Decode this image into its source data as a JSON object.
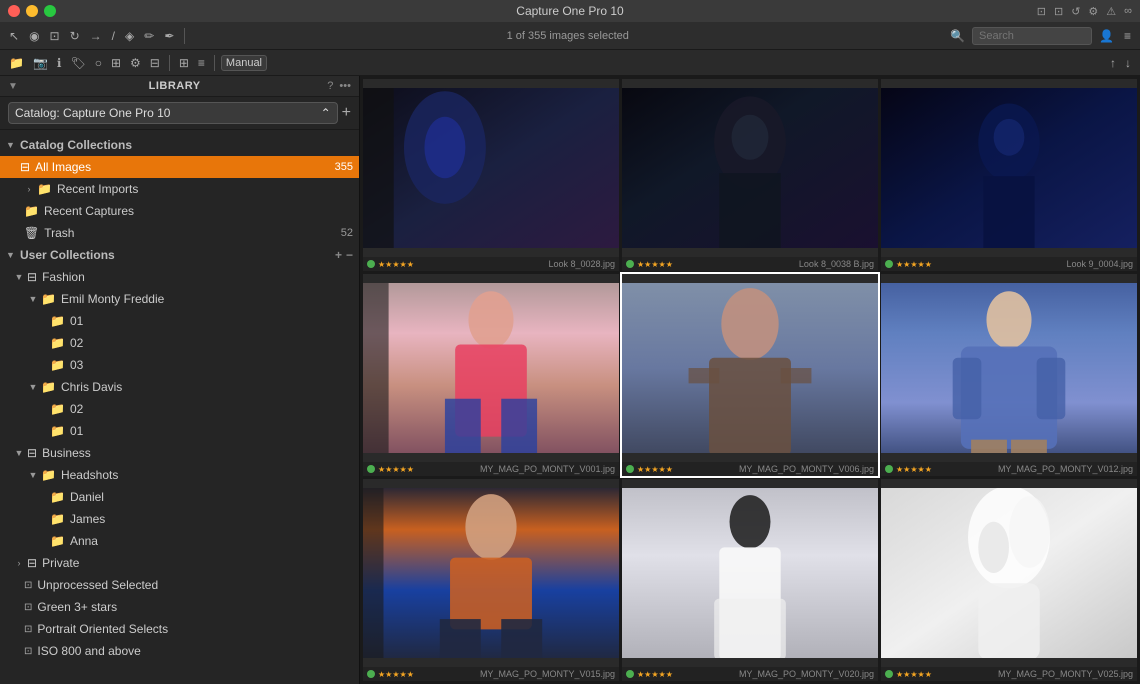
{
  "titlebar": {
    "title": "Capture One Pro 10",
    "traffic": [
      "red",
      "yellow",
      "green"
    ]
  },
  "toolbar": {
    "status": "1 of 355 images selected",
    "search_placeholder": "Search",
    "view_mode": "Manual"
  },
  "sidebar": {
    "title": "LIBRARY",
    "catalog_label": "Catalog: Capture One Pro 10",
    "catalog_collections_label": "Catalog Collections",
    "all_images_label": "All Images",
    "all_images_count": "355",
    "recent_imports_label": "Recent Imports",
    "recent_captures_label": "Recent Captures",
    "trash_label": "Trash",
    "trash_count": "52",
    "user_collections_label": "User Collections",
    "fashion_label": "Fashion",
    "emil_monty_freddie_label": "Emil Monty Freddie",
    "folder_01a_label": "01",
    "folder_02a_label": "02",
    "folder_03a_label": "03",
    "chris_davis_label": "Chris Davis",
    "folder_02b_label": "02",
    "folder_01b_label": "01",
    "business_label": "Business",
    "headshots_label": "Headshots",
    "daniel_label": "Daniel",
    "james_label": "James",
    "anna_label": "Anna",
    "private_label": "Private",
    "unprocessed_label": "Unprocessed Selected",
    "green_stars_label": "Green 3+ stars",
    "portrait_label": "Portrait Oriented Selects",
    "iso_label": "ISO 800 and above"
  },
  "images": [
    {
      "filename": "Look 8_0028.jpg",
      "stars": "★★★★★",
      "type": "dark_fashion",
      "selected": false,
      "partial": true
    },
    {
      "filename": "Look 8_0038 B.jpg",
      "stars": "★★★★★",
      "type": "dark_fashion2",
      "selected": false,
      "partial": false
    },
    {
      "filename": "Look 9_0004.jpg",
      "stars": "★★★★★",
      "type": "blue_portrait",
      "selected": false,
      "partial": false
    },
    {
      "filename": "MY_MAG_PO_MONTY_V001.jpg",
      "stars": "★★★★★",
      "type": "pink_dress",
      "selected": false,
      "partial": true
    },
    {
      "filename": "MY_MAG_PO_MONTY_V006.jpg",
      "stars": "★★★★★",
      "type": "selected_portrait",
      "selected": true,
      "partial": false
    },
    {
      "filename": "MY_MAG_PO_MONTY_V012.jpg",
      "stars": "★★★★★",
      "type": "denim_jacket",
      "selected": false,
      "partial": false
    },
    {
      "filename": "MY_MAG_PO_MONTY_V015.jpg",
      "stars": "★★★★★",
      "type": "orange_top",
      "selected": false,
      "partial": true
    },
    {
      "filename": "MY_MAG_PO_MONTY_V020.jpg",
      "stars": "★★★★★",
      "type": "white_dress",
      "selected": false,
      "partial": false
    },
    {
      "filename": "MY_MAG_PO_MONTY_V025.jpg",
      "stars": "★★★★★",
      "type": "white_sculpture",
      "selected": false,
      "partial": false
    }
  ]
}
